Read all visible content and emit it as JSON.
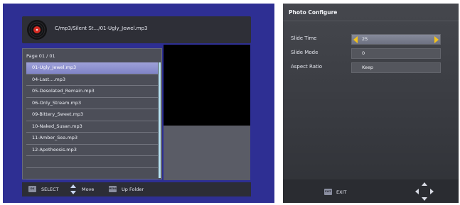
{
  "music_browser": {
    "path": "C/mp3/Silent St.../01-Ugly_Jewel.mp3",
    "page_label": "Page  01 / 01",
    "files": [
      "01-Ugly_Jewel.mp3",
      "04-Last....mp3",
      "05-Desolated_Remain.mp3",
      "06-Only_Stream.mp3",
      "09-Bittery_Sweet.mp3",
      "10-Naked_Susan.mp3",
      "11-Amber_Sea.mp3",
      "12-Apotheosis.mp3",
      "",
      "",
      ""
    ],
    "selected_index": 0,
    "footer": {
      "ok_key": "OK",
      "select_label": "SELECT",
      "move_label": "Move",
      "menu_key": "MENU",
      "up_folder_label": "Up Folder"
    }
  },
  "photo_configure": {
    "title": "Photo Configure",
    "settings": [
      {
        "label": "Slide Time",
        "value": "25"
      },
      {
        "label": "Slide Mode",
        "value": "0"
      },
      {
        "label": "Aspect Ratio",
        "value": "Keep"
      }
    ],
    "footer": {
      "exit_key": "EXIT",
      "exit_label": "EXIT"
    }
  },
  "colors": {
    "browser_bg": "#2e2f93",
    "selection": "#8f93cf",
    "scrollbar": "#b8e4f4",
    "arrow_accent": "#f4c21a"
  }
}
